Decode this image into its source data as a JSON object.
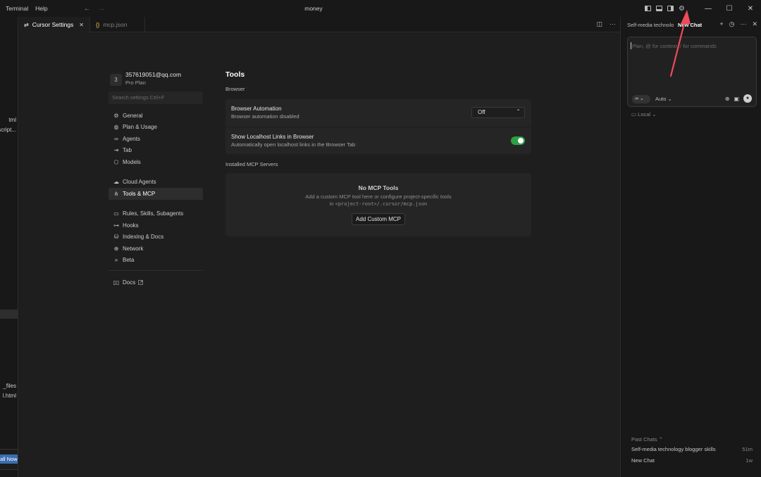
{
  "titlebar": {
    "menus": [
      "Terminal",
      "Help"
    ],
    "back_icon": "arrow-left-icon",
    "forward_icon": "arrow-right-icon",
    "title": "money"
  },
  "left_strip": {
    "items": [
      "tml",
      "script...",
      "_files",
      "l.html"
    ],
    "install_label": "tall Now"
  },
  "editor_tabs": {
    "active": "Cursor Settings",
    "inactive": "mcp.json",
    "json_icon": "{}"
  },
  "account": {
    "avatar_letter": "3",
    "email": "357619051@qq.com",
    "plan": "Pro Plan"
  },
  "search": {
    "placeholder": "Search settings Ctrl+F"
  },
  "nav": {
    "group1": [
      {
        "label": "General",
        "icon": "gear-icon"
      },
      {
        "label": "Plan & Usage",
        "icon": "globe-icon"
      },
      {
        "label": "Agents",
        "icon": "infinity-icon"
      },
      {
        "label": "Tab",
        "icon": "tab-arrow-icon"
      },
      {
        "label": "Models",
        "icon": "cube-icon"
      }
    ],
    "group2": [
      {
        "label": "Cloud Agents",
        "icon": "cloud-icon"
      },
      {
        "label": "Tools & MCP",
        "icon": "tools-icon",
        "active": true
      }
    ],
    "group3": [
      {
        "label": "Rules, Skills, Subagents",
        "icon": "rules-icon"
      },
      {
        "label": "Hooks",
        "icon": "hooks-icon"
      },
      {
        "label": "Indexing & Docs",
        "icon": "database-icon"
      },
      {
        "label": "Network",
        "icon": "globe-icon"
      },
      {
        "label": "Beta",
        "icon": "chevrons-icon"
      }
    ],
    "docs": "Docs"
  },
  "tools": {
    "title": "Tools",
    "browser_heading": "Browser",
    "rows": [
      {
        "title": "Browser Automation",
        "desc": "Browser automation disabled",
        "select_value": "Off"
      },
      {
        "title": "Show Localhost Links in Browser",
        "desc": "Automatically open localhost links in the Browser Tab",
        "toggle_on": true
      }
    ],
    "mcp_heading": "Installed MCP Servers",
    "empty_title": "No MCP Tools",
    "empty_desc_line1": "Add a custom MCP tool here or configure project-specific tools",
    "empty_desc_prefix": "in ",
    "empty_desc_path": "<project-root>/.cursor/mcp.json",
    "add_button": "Add Custom MCP"
  },
  "chat": {
    "tab1": "Self-media technolo",
    "tab2": "New Chat",
    "placeholder": "Plan, @ for context, / for commands",
    "mode_glyph": "∞",
    "model": "Auto",
    "local": "Local",
    "past_heading": "Past Chats",
    "past": [
      {
        "title": "Self-media technology blogger skills",
        "time": "51m"
      },
      {
        "title": "New Chat",
        "time": "1w"
      }
    ]
  },
  "colors": {
    "toggle_on": "#2ea043",
    "annotation_arrow": "#ee4b5b",
    "json_icon": "#e2c04a"
  }
}
